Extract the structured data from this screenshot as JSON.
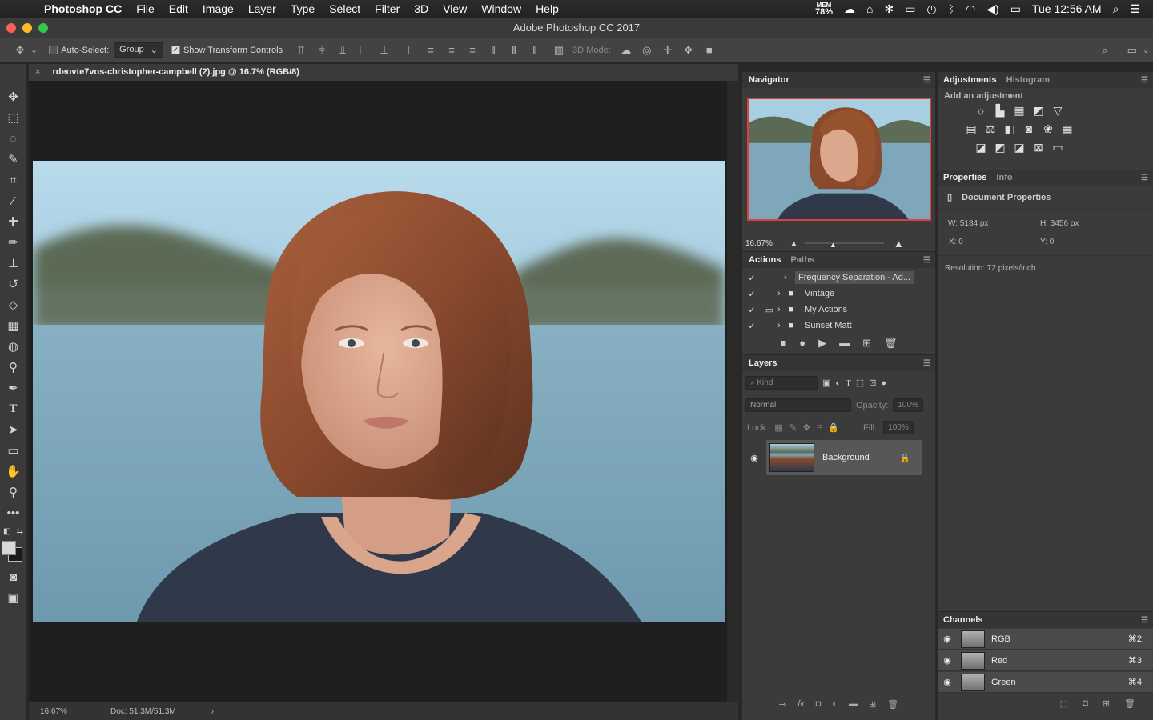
{
  "menubar": {
    "app": "Photoshop CC",
    "items": [
      "File",
      "Edit",
      "Image",
      "Layer",
      "Type",
      "Select",
      "Filter",
      "3D",
      "View",
      "Window",
      "Help"
    ],
    "mem_label": "MEM",
    "mem_value": "78%",
    "clock": "Tue 12:56 AM"
  },
  "window": {
    "title": "Adobe Photoshop CC 2017"
  },
  "options": {
    "auto_select_label": "Auto-Select:",
    "auto_select_value": "Group",
    "show_transform_label": "Show Transform Controls",
    "mode_3d_label": "3D Mode:"
  },
  "document": {
    "tab_title": "rdeovte7vos-christopher-campbell (2).jpg @ 16.7% (RGB/8)",
    "zoom": "16.67%",
    "doc_size": "Doc: 51.3M/51.3M"
  },
  "navigator": {
    "tab": "Navigator",
    "zoom": "16.67%"
  },
  "actions": {
    "tabs": [
      "Actions",
      "Paths"
    ],
    "items": [
      {
        "label": "Frequency Separation - Ad..."
      },
      {
        "label": "Vintage"
      },
      {
        "label": "My Actions"
      },
      {
        "label": "Sunset Matt"
      }
    ]
  },
  "layers": {
    "tab": "Layers",
    "kind_placeholder": "Kind",
    "blend_mode": "Normal",
    "opacity_label": "Opacity:",
    "opacity_value": "100%",
    "lock_label": "Lock:",
    "fill_label": "Fill:",
    "fill_value": "100%",
    "items": [
      {
        "label": "Background"
      }
    ]
  },
  "adjustments": {
    "tabs": [
      "Adjustments",
      "Histogram"
    ],
    "add_label": "Add an adjustment"
  },
  "properties": {
    "tabs": [
      "Properties",
      "Info"
    ],
    "doc_label": "Document Properties",
    "w": "W:  5184 px",
    "h": "H:  3456 px",
    "x": "X:  0",
    "y": "Y:  0",
    "resolution": "Resolution: 72 pixels/inch"
  },
  "channels": {
    "tab": "Channels",
    "items": [
      {
        "label": "RGB",
        "shortcut": "⌘2"
      },
      {
        "label": "Red",
        "shortcut": "⌘3"
      },
      {
        "label": "Green",
        "shortcut": "⌘4"
      }
    ]
  },
  "colors": {
    "traffic_close": "#fc5f57",
    "traffic_min": "#fdbc2e",
    "traffic_max": "#33c748",
    "navigator_frame": "#e0403a"
  }
}
